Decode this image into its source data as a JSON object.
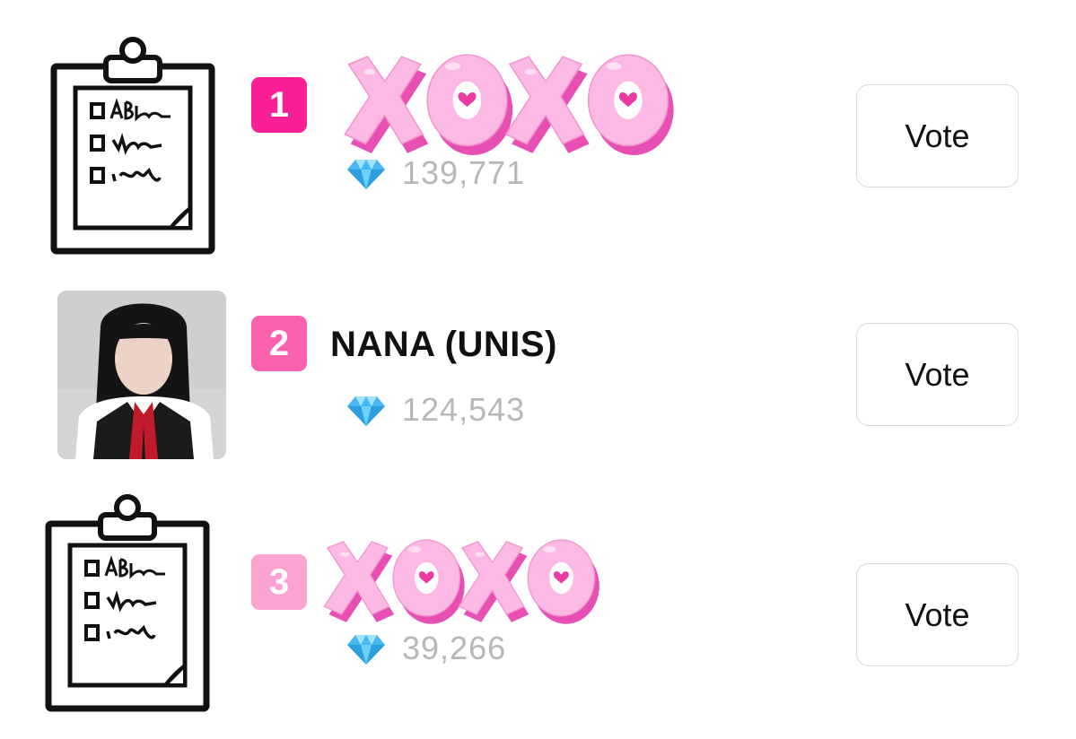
{
  "vote_list": {
    "items": [
      {
        "rank": "1",
        "name": "",
        "count": "139,771",
        "vote_label": "Vote",
        "thumb": "clipboard-icon",
        "overlay": "xoxo-sticker"
      },
      {
        "rank": "2",
        "name": "NANA (UNIS)",
        "count": "124,543",
        "vote_label": "Vote",
        "thumb": "artist-photo"
      },
      {
        "rank": "3",
        "name": "",
        "count": "39,266",
        "vote_label": "Vote",
        "thumb": "clipboard-icon",
        "overlay": "xoxo-sticker"
      }
    ]
  },
  "colors": {
    "rank_1": "#fa1f95",
    "rank_2": "#fb62ad",
    "rank_3": "#fda3cf",
    "count_text": "#b7b7b7",
    "sticker_pink": "#fbb9e3"
  }
}
